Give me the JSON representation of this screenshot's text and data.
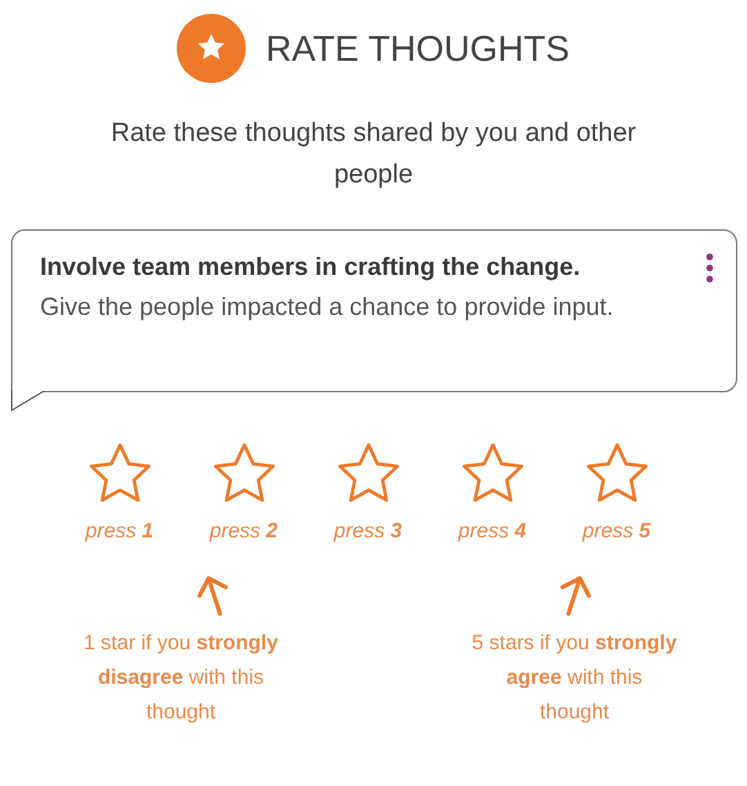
{
  "header": {
    "title": "RATE THOUGHTS"
  },
  "subtitle": "Rate these thoughts shared by you and other people",
  "thought": {
    "title": "Involve team members in crafting the change.",
    "text": "Give the people impacted a chance to provide input."
  },
  "rating": {
    "options": [
      {
        "label": "press **1**"
      },
      {
        "label": "press **2**"
      },
      {
        "label": "press **3**"
      },
      {
        "label": "press **4**"
      },
      {
        "label": "press **5**"
      }
    ]
  },
  "hints": [
    {
      "text": "1 star if you **strongly disagree** with this thought"
    },
    {
      "text": "5 stars if you **strongly agree** with this thought"
    }
  ]
}
